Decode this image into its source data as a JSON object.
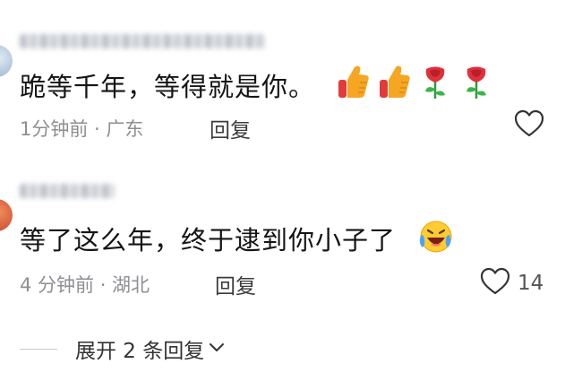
{
  "comments": [
    {
      "author": "",
      "text": "跪等千年，等得就是你。",
      "emojis": [
        "thumbs-up-icon",
        "thumbs-up-icon",
        "rose-icon",
        "rose-icon"
      ],
      "meta": "1分钟前 · 广东",
      "reply_label": "回复",
      "like_count": ""
    },
    {
      "author": "",
      "text": "等了这么年，终于逮到你小子了",
      "emojis": [
        "laughing-crying-icon"
      ],
      "meta": "4 分钟前 · 湖北",
      "reply_label": "回复",
      "like_count": "14"
    }
  ],
  "expand_replies": {
    "label": "展开 2 条回复"
  },
  "colors": {
    "text": "#151515",
    "meta": "#8e8e93",
    "thumb": "#f5a623",
    "rose": "#e0303b"
  }
}
